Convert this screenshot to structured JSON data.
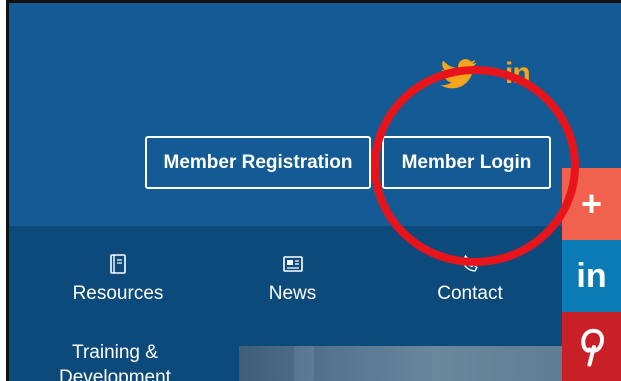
{
  "header": {
    "social": {
      "twitter_icon": "twitter-icon",
      "linkedin_text": "in"
    },
    "buttons": {
      "registration_label": "Member Registration",
      "login_label": "Member Login"
    }
  },
  "nav": {
    "items": [
      {
        "label": "Resources",
        "icon": "book-icon"
      },
      {
        "label": "News",
        "icon": "newspaper-icon"
      },
      {
        "label": "Contact",
        "icon": "phone-icon"
      }
    ],
    "training_line1": "Training &",
    "training_line2": "Development"
  },
  "share_bar": {
    "plus": "+",
    "linkedin": "in",
    "pinterest_icon": "pinterest-icon"
  },
  "colors": {
    "header_bg": "#145b95",
    "nav_bg": "#0d4a7c",
    "accent_social": "#f4a51c",
    "annotation_circle": "#e8141c",
    "share_plus": "#f0614e",
    "share_linkedin": "#0b7bb5",
    "share_pinterest": "#c91f27"
  }
}
